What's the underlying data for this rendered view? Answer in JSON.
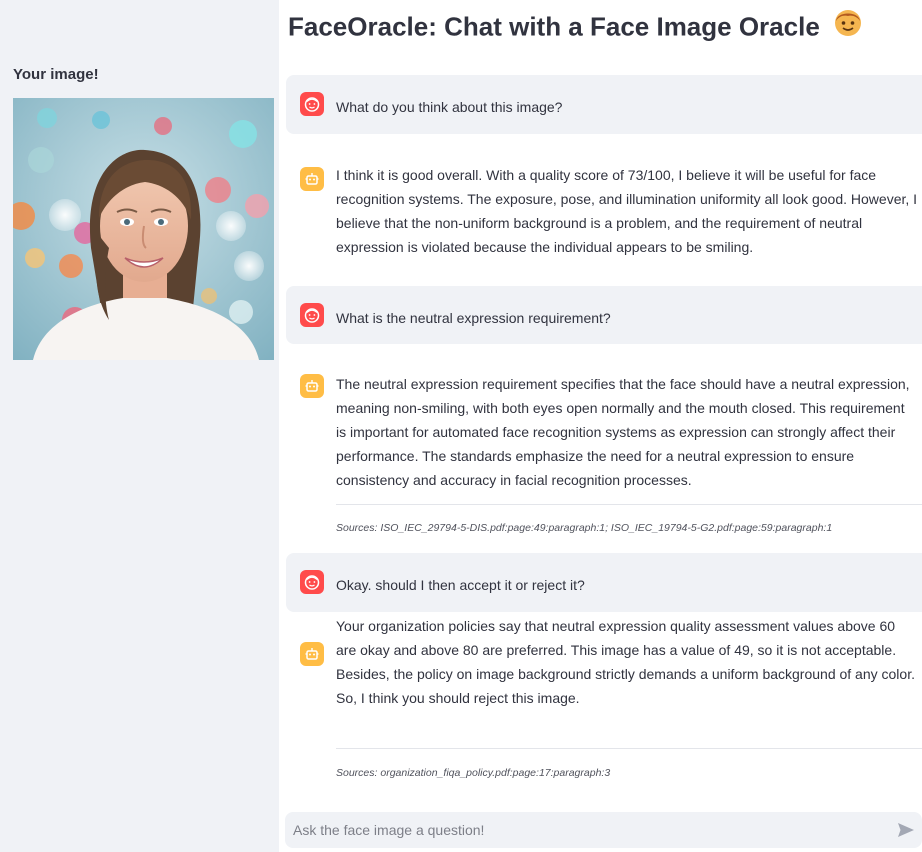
{
  "sidebar": {
    "title": "Your image!"
  },
  "page": {
    "title": "FaceOracle: Chat with a Face Image Oracle",
    "title_icon": "child-face-emoji"
  },
  "messages": [
    {
      "role": "user",
      "avatar_icon": "user-face-icon",
      "text": "What do you think about this image?"
    },
    {
      "role": "assistant",
      "avatar_icon": "robot-icon",
      "text": "I think it is good overall. With a quality score of 73/100, I believe it will be useful for face recognition systems. The exposure, pose, and illumination uniformity all look good. However, I believe that the non-uniform background is a problem, and the requirement of neutral expression is violated because the individual appears to be smiling."
    },
    {
      "role": "user",
      "avatar_icon": "user-face-icon",
      "text": "What is the neutral expression requirement?"
    },
    {
      "role": "assistant",
      "avatar_icon": "robot-icon",
      "text": "The neutral expression requirement specifies that the face should have a neutral expression, meaning non-smiling, with both eyes open normally and the mouth closed. This requirement is important for automated face recognition systems as expression can strongly affect their performance. The standards emphasize the need for a neutral expression to ensure consistency and accuracy in facial recognition processes.",
      "sources": "Sources: ISO_IEC_29794-5-DIS.pdf:page:49:paragraph:1; ISO_IEC_19794-5-G2.pdf:page:59:paragraph:1"
    },
    {
      "role": "user",
      "avatar_icon": "user-face-icon",
      "text": "Okay. should I then accept it or reject it?"
    },
    {
      "role": "assistant",
      "avatar_icon": "robot-icon",
      "text": "Your organization policies say that neutral expression quality assessment values above 60 are okay and above 80 are preferred. This image has a value of 49, so it is not acceptable. Besides, the policy on image background strictly demands a uniform background of any color. So, I think you should reject this image.",
      "sources": "Sources: organization_fiqa_policy.pdf:page:17:paragraph:3"
    }
  ],
  "chat_input": {
    "placeholder": "Ask the face image a question!",
    "value": "",
    "send_icon": "send-arrow-icon"
  },
  "colors": {
    "sidebar_bg": "#f0f2f6",
    "user_avatar": "#ff4b4b",
    "assistant_avatar": "#ffbd45",
    "text": "#31333f"
  }
}
